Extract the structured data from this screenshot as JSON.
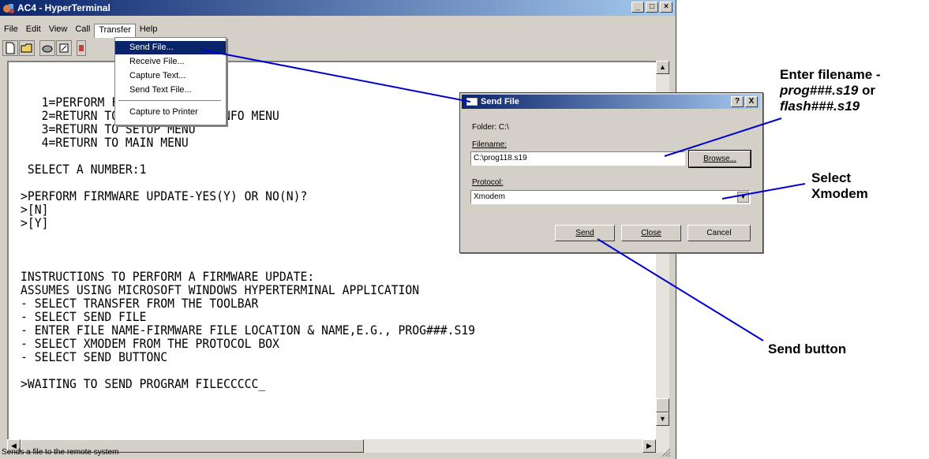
{
  "window": {
    "title": "AC4 - HyperTerminal"
  },
  "menu": [
    "File",
    "Edit",
    "View",
    "Call",
    "Transfer",
    "Help"
  ],
  "transfer_menu": {
    "items": [
      "Send File...",
      "Receive File...",
      "Capture Text...",
      "Send Text File...",
      "Capture to Printer"
    ],
    "selected": "Send File..."
  },
  "terminal_lines": [
    "   1=PERFORM FIRMWARE UPDATE",
    "   2=RETURN TO SETUP SYSTEM INFO MENU",
    "   3=RETURN TO SETUP MENU",
    "   4=RETURN TO MAIN MENU",
    "",
    " SELECT A NUMBER:1",
    "",
    ">PERFORM FIRMWARE UPDATE-YES(Y) OR NO(N)?",
    ">[N]",
    ">[Y]",
    "",
    "",
    "",
    "INSTRUCTIONS TO PERFORM A FIRMWARE UPDATE:",
    "ASSUMES USING MICROSOFT WINDOWS HYPERTERMINAL APPLICATION",
    "- SELECT TRANSFER FROM THE TOOLBAR",
    "- SELECT SEND FILE",
    "- ENTER FILE NAME-FIRMWARE FILE LOCATION & NAME,E.G., PROG###.S19",
    "- SELECT XMODEM FROM THE PROTOCOL BOX",
    "- SELECT SEND BUTTONC",
    "",
    ">WAITING TO SEND PROGRAM FILECCCCC_"
  ],
  "status": "Sends a file to the remote system",
  "dialog": {
    "title": "Send File",
    "folder": "Folder: C:\\",
    "filename_label": "Filename:",
    "filename_value": "C:\\prog118.s19",
    "browse": "Browse...",
    "protocol_label": "Protocol:",
    "protocol_value": "Xmodem",
    "send": "Send",
    "close": "Close",
    "cancel": "Cancel",
    "help_btn": "?",
    "close_btn": "X"
  },
  "annotations": {
    "filename_line1": "Enter filename -",
    "filename_italic1": "prog###.s19",
    "filename_or": " or",
    "filename_italic2": "flash###.s19",
    "protocol_line1": "Select",
    "protocol_line2": "Xmodem",
    "send": "Send button"
  },
  "colors": {
    "titlebar": "#0a246a",
    "annotation_line": "#0000cc"
  }
}
